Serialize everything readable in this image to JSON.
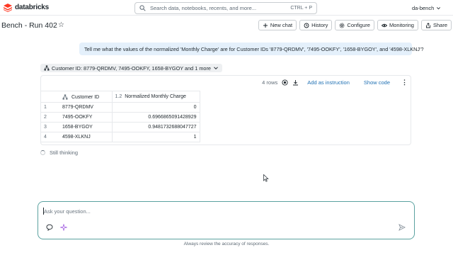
{
  "brand": {
    "name": "databricks",
    "accent": "#ff3621"
  },
  "search": {
    "placeholder": "Search data, notebooks, recents, and more...",
    "shortcut": "CTRL + P"
  },
  "workspace": {
    "name": "da-bench"
  },
  "page": {
    "title": "Bench - Run 402"
  },
  "actions": [
    {
      "label": "New chat",
      "icon": "plus-icon"
    },
    {
      "label": "History",
      "icon": "history-icon"
    },
    {
      "label": "Configure",
      "icon": "gear-icon"
    },
    {
      "label": "Monitoring",
      "icon": "eye-icon"
    },
    {
      "label": "Share",
      "icon": "share-icon"
    }
  ],
  "conversation": {
    "user_message": "Tell me what the values of the normalized 'Monthly Charge' are for Customer IDs '8779-QRDMV', '7495-OOKFY', '1658-BYGOY', and '4598-XLKNJ'?",
    "filter_label": "Customer ID: 8779-QRDMV, 7495-OOKFY, 1658-BYGOY and 1 more",
    "row_count": "4 rows",
    "add_instruction": "Add as instruction",
    "show_code": "Show code",
    "status": "Still thinking"
  },
  "table": {
    "columns": [
      "Customer ID",
      "Normalized Monthly Charge"
    ],
    "type_badge": "1.2",
    "rows": [
      {
        "idx": "1",
        "id": "8779-QRDMV",
        "value": "0"
      },
      {
        "idx": "2",
        "id": "7495-OOKFY",
        "value": "0.6966865091428929"
      },
      {
        "idx": "3",
        "id": "1658-BYGOY",
        "value": "0.9481732688047727"
      },
      {
        "idx": "4",
        "id": "4598-XLKNJ",
        "value": "1"
      }
    ]
  },
  "composer": {
    "placeholder": "Ask your question...",
    "disclaimer": "Always review the accuracy of responses."
  }
}
